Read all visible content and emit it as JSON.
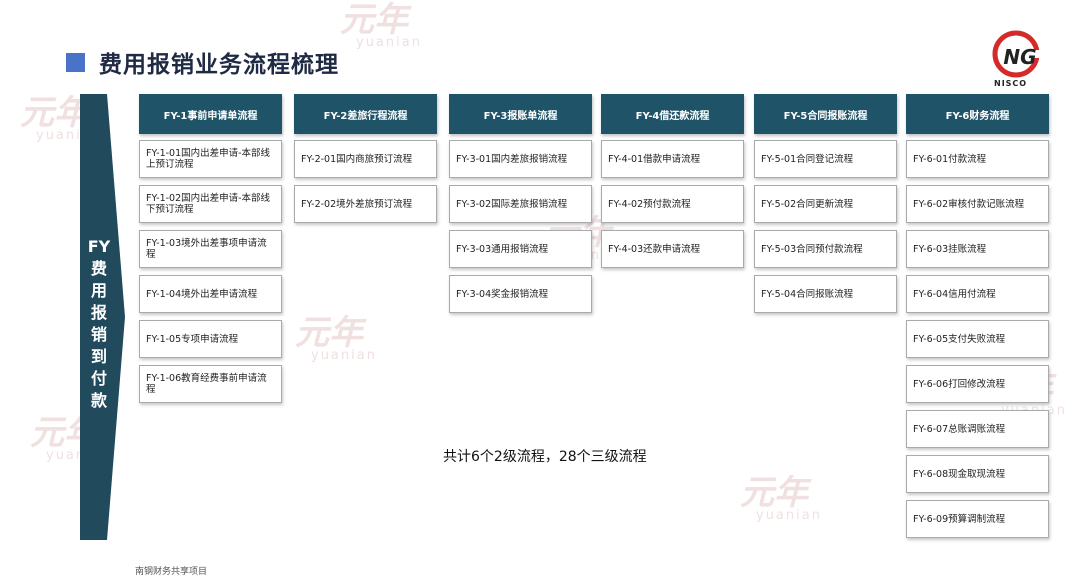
{
  "title": "费用报销业务流程梳理",
  "logo_text": "NISCO",
  "arrow_label": "FY费用报销到付款",
  "watermark": {
    "cn": "元年",
    "en": "yuanian"
  },
  "summary": "共计6个2级流程，28个三级流程",
  "footer": "南钢财务共享项目",
  "columns": [
    {
      "header": "FY-1事前申请单流程",
      "items": [
        "FY-1-01国内出差申请-本部线上预订流程",
        "FY-1-02国内出差申请-本部线下预订流程",
        "FY-1-03境外出差事项申请流程",
        "FY-1-04境外出差申请流程",
        "FY-1-05专项申请流程",
        "FY-1-06教育经费事前申请流程"
      ]
    },
    {
      "header": "FY-2差旅行程流程",
      "items": [
        "FY-2-01国内商旅预订流程",
        "FY-2-02境外差旅预订流程"
      ]
    },
    {
      "header": "FY-3报账单流程",
      "items": [
        "FY-3-01国内差旅报销流程",
        "FY-3-02国际差旅报销流程",
        "FY-3-03通用报销流程",
        "FY-3-04奖金报销流程"
      ]
    },
    {
      "header": "FY-4借还款流程",
      "items": [
        "FY-4-01借款申请流程",
        "FY-4-02预付款流程",
        "FY-4-03还款申请流程"
      ]
    },
    {
      "header": "FY-5合同报账流程",
      "items": [
        "FY-5-01合同登记流程",
        "FY-5-02合同更新流程",
        "FY-5-03合同预付款流程",
        "FY-5-04合同报账流程"
      ]
    },
    {
      "header": "FY-6财务流程",
      "items": [
        "FY-6-01付款流程",
        "FY-6-02审核付款记账流程",
        "FY-6-03挂账流程",
        "FY-6-04信用付流程",
        "FY-6-05支付失败流程",
        "FY-6-06打回修改流程",
        "FY-6-07总账调账流程",
        "FY-6-08现金取现流程",
        "FY-6-09预算调制流程"
      ]
    }
  ]
}
